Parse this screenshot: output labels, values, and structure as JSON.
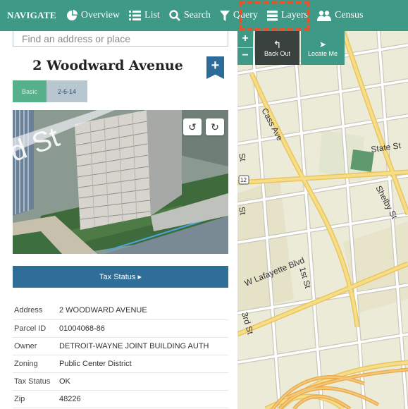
{
  "nav": {
    "title": "NAVIGATE",
    "items": [
      {
        "label": "Overview",
        "icon": "pie-chart-icon"
      },
      {
        "label": "List",
        "icon": "list-icon"
      },
      {
        "label": "Search",
        "icon": "magnifier-icon"
      },
      {
        "label": "Query",
        "icon": "filter-funnel-icon"
      },
      {
        "label": "Layers",
        "icon": "layers-stack-icon"
      },
      {
        "label": "Census",
        "icon": "people-icon"
      }
    ],
    "highlight_color": "#e2542b"
  },
  "search": {
    "placeholder": "Find an address or place"
  },
  "parcel": {
    "title": "2 Woodward Avenue",
    "tabs": {
      "basic": "Basic",
      "date": "2-6-14"
    },
    "photo_street_label": "d St",
    "tax_button": "Tax Status ▸",
    "fields": [
      {
        "key": "Address",
        "value": "2 WOODWARD AVENUE"
      },
      {
        "key": "Parcel ID",
        "value": "01004068-86"
      },
      {
        "key": "Owner",
        "value": "DETROIT-WAYNE JOINT BUILDING AUTH"
      },
      {
        "key": "Zoning",
        "value": "Public Center District"
      },
      {
        "key": "Tax Status",
        "value": "OK"
      },
      {
        "key": "Zip",
        "value": "48226"
      }
    ]
  },
  "map": {
    "zoom_in": "+",
    "zoom_out": "−",
    "back_out": "Back Out",
    "locate_me": "Locate Me",
    "labels": {
      "cass": "Cass Ave",
      "state": "State St",
      "shelby": "Shelby St",
      "lafayette": "W Lafayette Blvd",
      "first": "1st St",
      "third": "3rd St",
      "route": "12",
      "st_left": "St",
      "st_left2": "St"
    }
  },
  "colors": {
    "nav": "#3e9a86",
    "dark_btn": "#39423f",
    "tax_bar": "#2f6e99",
    "road": "#f6d677"
  }
}
